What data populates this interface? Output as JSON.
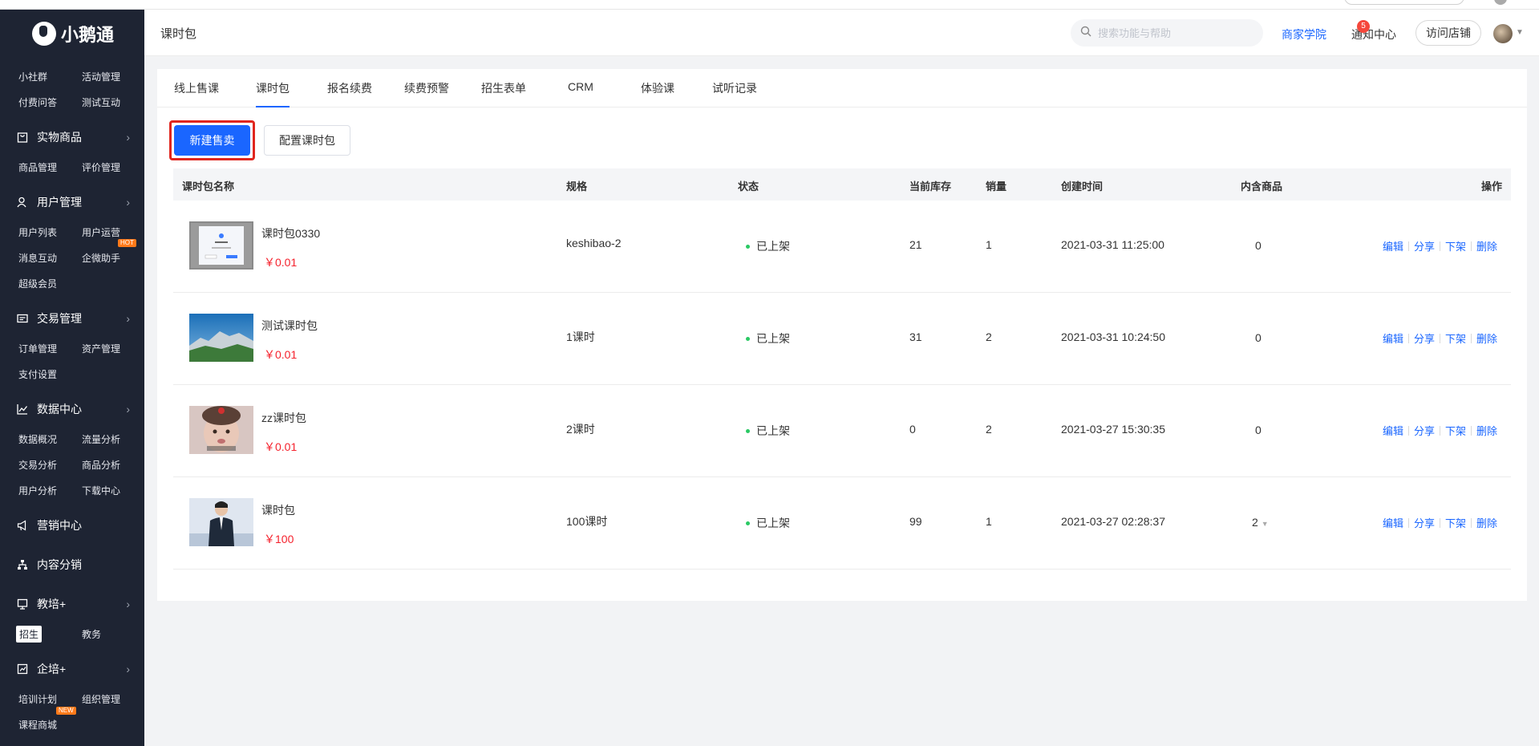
{
  "app": {
    "logo_text": "小鹅通"
  },
  "sidebar": {
    "top_items": [
      "小社群",
      "活动管理",
      "付费问答",
      "测试互动"
    ],
    "physical": {
      "label": "实物商品",
      "items": [
        "商品管理",
        "评价管理"
      ]
    },
    "users": {
      "label": "用户管理",
      "items": [
        "用户列表",
        "用户运营",
        "消息互动",
        "企微助手",
        "超级会员"
      ],
      "hot": "HOT"
    },
    "trade": {
      "label": "交易管理",
      "items": [
        "订单管理",
        "资产管理",
        "支付设置"
      ]
    },
    "data": {
      "label": "数据中心",
      "items": [
        "数据概况",
        "流量分析",
        "交易分析",
        "商品分析",
        "用户分析",
        "下载中心"
      ]
    },
    "marketing": {
      "label": "营销中心"
    },
    "content": {
      "label": "内容分销"
    },
    "edu": {
      "label": "教培+",
      "items": [
        "招生",
        "教务"
      ]
    },
    "corp": {
      "label": "企培+",
      "items": [
        "培训计划",
        "组织管理",
        "课程商城"
      ],
      "new": "NEW"
    }
  },
  "header": {
    "title": "课时包",
    "search_placeholder": "搜索功能与帮助",
    "academy": "商家学院",
    "notify": "通知中心",
    "notify_count": "5",
    "visit": "访问店铺"
  },
  "tabs": [
    "线上售课",
    "课时包",
    "报名续费",
    "续费预警",
    "招生表单",
    "CRM",
    "体验课",
    "试听记录"
  ],
  "toolbar": {
    "new_sale": "新建售卖",
    "config": "配置课时包"
  },
  "table": {
    "columns": [
      "课时包名称",
      "规格",
      "状态",
      "当前库存",
      "销量",
      "创建时间",
      "内含商品",
      "操作"
    ],
    "actions": [
      "编辑",
      "分享",
      "下架",
      "删除"
    ],
    "rows": [
      {
        "name": "课时包0330",
        "price": "￥0.01",
        "spec": "keshibao-2",
        "status": "已上架",
        "stock": "21",
        "sales": "1",
        "created": "2021-03-31 11:25:00",
        "contains": "0"
      },
      {
        "name": "测试课时包",
        "price": "￥0.01",
        "spec": "1课时",
        "status": "已上架",
        "stock": "31",
        "sales": "2",
        "created": "2021-03-31 10:24:50",
        "contains": "0"
      },
      {
        "name": "zz课时包",
        "price": "￥0.01",
        "spec": "2课时",
        "status": "已上架",
        "stock": "0",
        "sales": "2",
        "created": "2021-03-27 15:30:35",
        "contains": "0"
      },
      {
        "name": "课时包",
        "price": "￥100",
        "spec": "100课时",
        "status": "已上架",
        "stock": "99",
        "sales": "1",
        "created": "2021-03-27 02:28:37",
        "contains": "2"
      }
    ]
  },
  "colors": {
    "primary": "#1a66ff",
    "sidebar_bg": "#1e2433",
    "price": "#f5222d",
    "status_dot": "#2ac964",
    "highlight": "#e0261f"
  }
}
